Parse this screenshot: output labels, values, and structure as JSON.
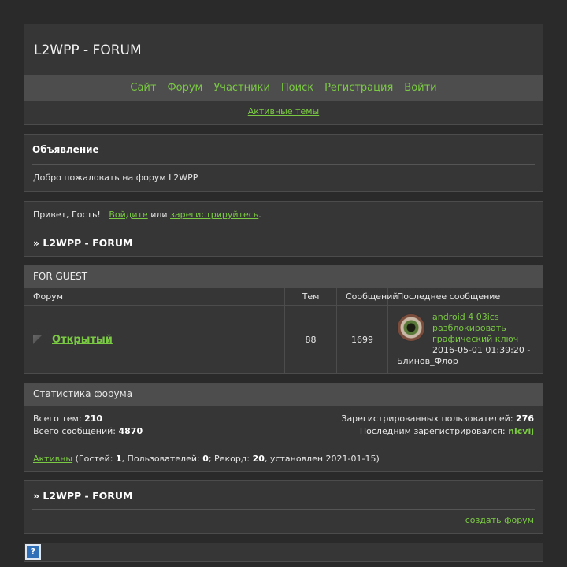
{
  "header": {
    "title": "L2WPP - FORUM",
    "nav": [
      "Сайт",
      "Форум",
      "Участники",
      "Поиск",
      "Регистрация",
      "Войти"
    ],
    "active_topics": "Активные темы"
  },
  "announcement": {
    "heading": "Объявление",
    "text": "Добро пожаловать на форум L2WPP"
  },
  "greeting": {
    "prefix": "Привет, Гость!",
    "login": "Войдите",
    "or": "или",
    "register": "зарегистрируйтесь",
    "suffix": ".",
    "crumb": "» L2WPP - FORUM"
  },
  "forum_table": {
    "category": "FOR GUEST",
    "columns": [
      "Форум",
      "Тем",
      "Сообщений",
      "Последнее сообщение"
    ],
    "rows": [
      {
        "name": "Открытый",
        "topics": "88",
        "posts": "1699",
        "last_post_title": "android 4 03ics разблокировать графический ключ",
        "last_post_time": "2016-05-01 01:39:20 -",
        "last_post_author": "Блинов_Флор"
      }
    ]
  },
  "stats": {
    "heading": "Статистика форума",
    "total_topics_label": "Всего тем:",
    "total_topics": "210",
    "total_posts_label": "Всего сообщений:",
    "total_posts": "4870",
    "registered_label": "Зарегистрированных пользователей:",
    "registered": "276",
    "last_registered_label": "Последним зарегистрировался:",
    "last_registered": "nlcvij",
    "online_link": "Активны",
    "online_guests_label": "(Гостей:",
    "online_guests": "1",
    "online_users_label": ", Пользователей:",
    "online_users": "0",
    "record_label": "; Рекорд:",
    "record": "20",
    "record_date": ", установлен 2021-01-15)"
  },
  "footer": {
    "crumb": "» L2WPP - FORUM",
    "create_forum": "создать форум",
    "help_icon": "?"
  }
}
